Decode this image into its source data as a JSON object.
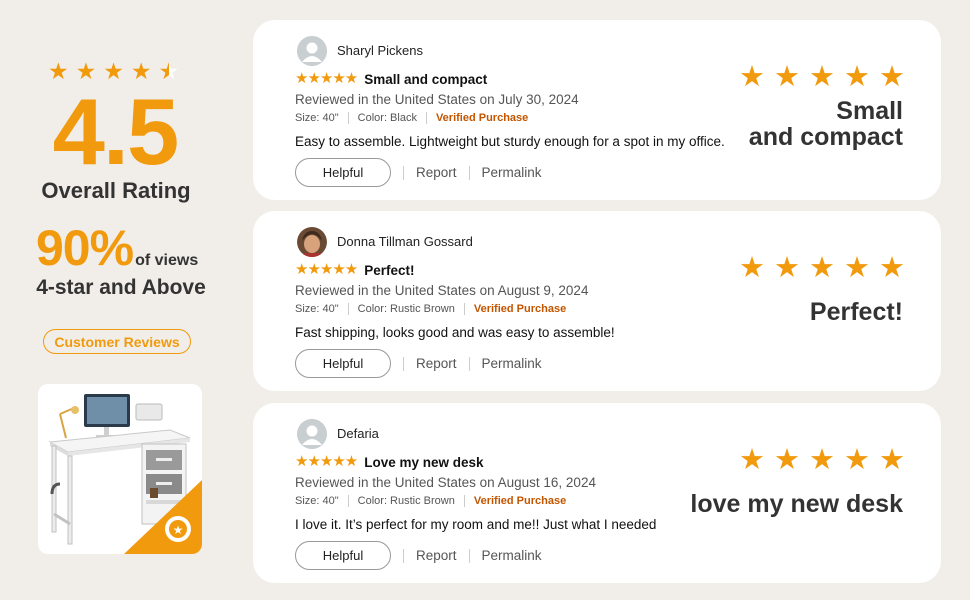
{
  "summary": {
    "stars_value": 4.5,
    "rating": "4.5",
    "rating_label": "Overall Rating",
    "percent": "90%",
    "percent_suffix": "of views",
    "percent_label": "4-star and Above",
    "badge": "Customer Reviews"
  },
  "colors": {
    "accent": "#f19a0e",
    "verified": "#c45500",
    "background": "#f1eee9"
  },
  "reviews": [
    {
      "author": "Sharyl Pickens",
      "avatar": "default-user-icon",
      "stars": "★★★★★",
      "title": "Small and compact",
      "date": "Reviewed in the United States on July 30, 2024",
      "size": "Size: 40\"",
      "color": "Color: Black",
      "verified": "Verified Purchase",
      "body": "Easy to assemble. Lightweight but sturdy enough for a spot in my office.",
      "helpful": "Helpful",
      "report": "Report",
      "permalink": "Permalink",
      "highlight": "Small\nand compact"
    },
    {
      "author": "Donna Tillman Gossard",
      "avatar": "user-photo",
      "stars": "★★★★★",
      "title": "Perfect!",
      "date": "Reviewed in the United States on August 9, 2024",
      "size": "Size: 40\"",
      "color": "Color: Rustic Brown",
      "verified": "Verified Purchase",
      "body": "Fast shipping, looks good and was easy to assemble!",
      "helpful": "Helpful",
      "report": "Report",
      "permalink": "Permalink",
      "highlight": "Perfect!"
    },
    {
      "author": "Defaria",
      "avatar": "default-user-icon",
      "stars": "★★★★★",
      "title": "Love my new desk",
      "date": "Reviewed in the United States on August 16, 2024",
      "size": "Size: 40\"",
      "color": "Color: Rustic Brown",
      "verified": "Verified Purchase",
      "body": "I love it. It’s perfect for my room and me!! Just what I needed",
      "helpful": "Helpful",
      "report": "Report",
      "permalink": "Permalink",
      "highlight": "love my new desk"
    }
  ]
}
